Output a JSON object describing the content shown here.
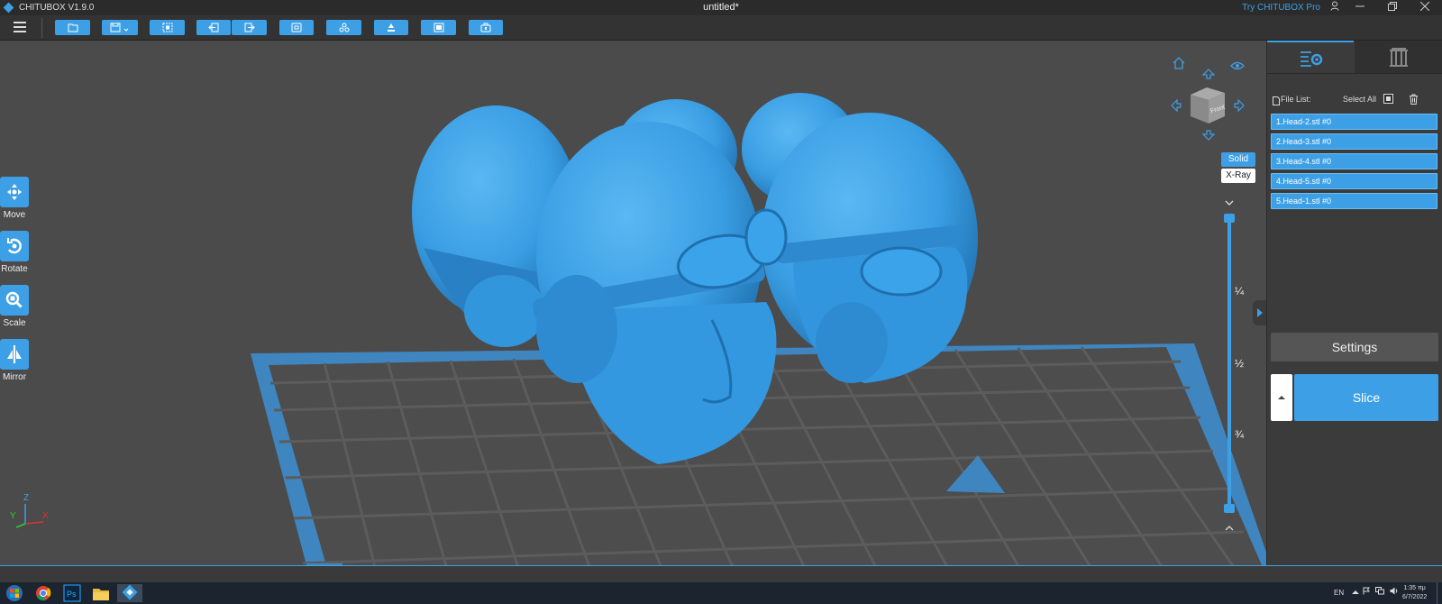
{
  "window": {
    "app_name": "CHITUBOX V1.9.0",
    "document_title": "untitled*",
    "try_pro": "Try CHITUBOX Pro"
  },
  "left_tools": [
    {
      "label": "Move",
      "icon": "move-icon"
    },
    {
      "label": "Rotate",
      "icon": "rotate-icon"
    },
    {
      "label": "Scale",
      "icon": "scale-icon"
    },
    {
      "label": "Mirror",
      "icon": "mirror-icon"
    }
  ],
  "view": {
    "cube_face": "Front",
    "modes": [
      "Solid",
      "X-Ray"
    ],
    "active_mode": "Solid"
  },
  "layer_slider": {
    "marks": [
      "¼",
      "½",
      "¾"
    ]
  },
  "right_panel": {
    "file_list_label": "File List:",
    "select_all_label": "Select All",
    "files": [
      "1.Head-2.stl #0",
      "2.Head-3.stl #0",
      "3.Head-4.stl #0",
      "4.Head-5.stl #0",
      "5.Head-1.stl #0"
    ],
    "settings_label": "Settings",
    "slice_label": "Slice"
  },
  "axes": {
    "z": "Z",
    "y": "Y",
    "x": "X"
  },
  "taskbar": {
    "language": "EN",
    "time": "1:35 πμ",
    "date": "6/7/2022"
  },
  "colors": {
    "accent": "#3da0e6",
    "model": "#3a9ee4",
    "plate": "#3f86c0"
  }
}
